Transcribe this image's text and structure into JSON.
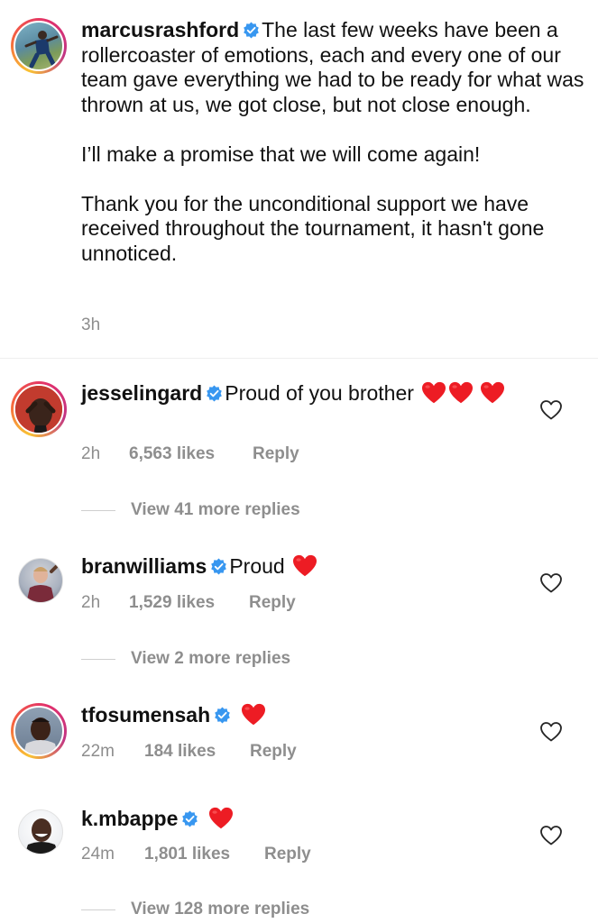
{
  "caption": {
    "username": "marcusrashford",
    "paragraphs": [
      "The last few weeks have been a rollercoaster of emotions, each and every one of our team gave everything we had to be ready for what was thrown at us, we got close, but not close enough.",
      "I’ll make a promise that we will come again!",
      "Thank you for the unconditional support we have received throughout the tournament, it hasn't gone unnoticed."
    ],
    "time": "3h"
  },
  "comments": [
    {
      "username": "jesselingard",
      "text": "Proud of you brother",
      "time": "2h",
      "likes": "6,563 likes",
      "reply": "Reply",
      "view_replies": "View 41 more replies"
    },
    {
      "username": "branwilliams",
      "text": "Proud",
      "time": "2h",
      "likes": "1,529 likes",
      "reply": "Reply",
      "view_replies": "View 2 more replies"
    },
    {
      "username": "tfosumensah",
      "text": "",
      "time": "22m",
      "likes": "184 likes",
      "reply": "Reply"
    },
    {
      "username": "k.mbappe",
      "text": "",
      "time": "24m",
      "likes": "1,801 likes",
      "reply": "Reply",
      "view_replies": "View 128 more replies"
    }
  ],
  "colors": {
    "verified": "#3897f0",
    "heart": "#ed1c24",
    "meta_gray": "#8e8e8e"
  },
  "icons": {
    "verified": "verified-badge-icon",
    "heart": "red-heart-emoji",
    "like": "heart-outline-icon"
  }
}
